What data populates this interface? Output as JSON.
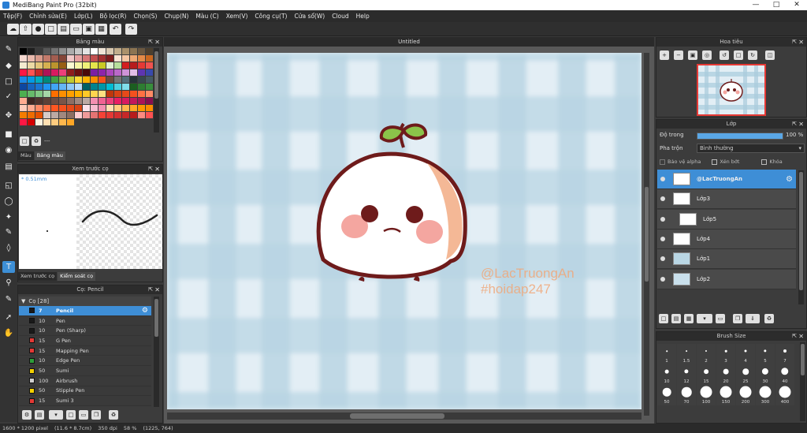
{
  "window": {
    "title": "MediBang Paint Pro (32bit)"
  },
  "menu": [
    "Tệp(F)",
    "Chỉnh sửa(E)",
    "Lớp(L)",
    "Bộ lọc(R)",
    "Chọn(S)",
    "Chụp(N)",
    "Màu (C)",
    "Xem(V)",
    "Công cụ(T)",
    "Cửa sổ(W)",
    "Cloud",
    "Help"
  ],
  "color_palette": {
    "title": "Bảng màu",
    "tab_color": "Màu",
    "tab_palette": "Bảng màu",
    "footer_text": "---",
    "swatches": [
      "#000000",
      "#1e1e1e",
      "#3a3a3a",
      "#575757",
      "#737373",
      "#8f8f8f",
      "#ababab",
      "#c7c7c7",
      "#e3e3e3",
      "#ffffff",
      "#efe4d6",
      "#d9c8b0",
      "#c2ad8c",
      "#aa916b",
      "#8c7452",
      "#6b5840",
      "#4c3f2e",
      "#f4d7cf",
      "#e9b9ac",
      "#d89a8b",
      "#c27a6b",
      "#a35d50",
      "#844538",
      "#f1c8c8",
      "#e6a0a0",
      "#d77878",
      "#c25050",
      "#a33030",
      "#7f1d1d",
      "#fbe3d3",
      "#f5c6a3",
      "#eea874",
      "#e38a48",
      "#c9671f",
      "#f5ebd0",
      "#ecd9a5",
      "#e3c57a",
      "#d6b050",
      "#bc942d",
      "#985f14",
      "#fcfcd2",
      "#f7f7a5",
      "#f0f078",
      "#e6e64b",
      "#c9c924",
      "#e0f0d2",
      "#b8e09c",
      "#d21f1f",
      "#b71c1c",
      "#e53935",
      "#ef5350",
      "#ff1744",
      "#ff5252",
      "#c62828",
      "#ad1457",
      "#d81b60",
      "#ec407a",
      "#8e1d1d",
      "#6a1010",
      "#4a0a0a",
      "#7b1fa2",
      "#8e24aa",
      "#ab47bc",
      "#ba68c8",
      "#ce93d8",
      "#e1bee7",
      "#5e35b1",
      "#3949ab",
      "#1e88e5",
      "#039be5",
      "#00acc1",
      "#00897b",
      "#43a047",
      "#7cb342",
      "#c0ca33",
      "#fdd835",
      "#ffb300",
      "#fb8c00",
      "#f4511e",
      "#6d4c41",
      "#757575",
      "#546e7a",
      "#263238",
      "#37474f",
      "#455a64",
      "#0d47a1",
      "#1565c0",
      "#1976d2",
      "#2196f3",
      "#42a5f5",
      "#64b5f6",
      "#90caf9",
      "#bbdefb",
      "#006064",
      "#00838f",
      "#0097a7",
      "#00bcd4",
      "#4dd0e1",
      "#80deea",
      "#1b5e20",
      "#2e7d32",
      "#388e3c",
      "#4caf50",
      "#66bb6a",
      "#81c784",
      "#a5d6a7",
      "#ff6f00",
      "#ff8f00",
      "#ffa000",
      "#ffb300",
      "#ffca28",
      "#ffd54f",
      "#ffe082",
      "#bf360c",
      "#d84315",
      "#e64a19",
      "#f4511e",
      "#ff7043",
      "#ff8a65",
      "#ffab91",
      "#3e2723",
      "#4e342e",
      "#5d4037",
      "#6d4c41",
      "#795548",
      "#8d6e63",
      "#a1887f",
      "#bcaaa4",
      "#f48fb1",
      "#f06292",
      "#ec407a",
      "#e91e63",
      "#d81b60",
      "#c2185b",
      "#ad1457",
      "#880e4f",
      "#ffccbc",
      "#ffab91",
      "#ff8a65",
      "#ff7043",
      "#ff5722",
      "#f4511e",
      "#e64a19",
      "#d84315",
      "#fce4ec",
      "#f8bbd0",
      "#f48fb1",
      "#ffe0b2",
      "#ffcc80",
      "#ffb74d",
      "#ffa726",
      "#ff9800",
      "#fb8c00",
      "#f57c00",
      "#ef6c00",
      "#e65100",
      "#d7ccc8",
      "#bcaaa4",
      "#a1887f",
      "#8d6e63",
      "#ffcdd2",
      "#ef9a9a",
      "#e57373",
      "#f44336",
      "#e53935",
      "#d32f2f",
      "#c62828",
      "#b71c1c",
      "#ff8a80",
      "#ff5252",
      "#ff1744",
      "#d50000",
      "#fff3e0",
      "#ffe0b2",
      "#ffcc80",
      "#ffb74d",
      "#ffa726"
    ]
  },
  "brush_preview": {
    "title": "Xem trước cọ",
    "size_label": "* 0.51mm",
    "tab_preview": "Xem trước cọ",
    "tab_control": "Kiểm soát cọ"
  },
  "brush_panel": {
    "title": "Cọ: Pencil",
    "group": "Cọ [28]",
    "brushes": [
      {
        "size": "7",
        "name": "Pencil",
        "color": "#1a1a1a"
      },
      {
        "size": "10",
        "name": "Pen",
        "color": "#1a1a1a"
      },
      {
        "size": "10",
        "name": "Pen (Sharp)",
        "color": "#1a1a1a"
      },
      {
        "size": "15",
        "name": "G Pen",
        "color": "#e53935"
      },
      {
        "size": "15",
        "name": "Mapping Pen",
        "color": "#e53935"
      },
      {
        "size": "10",
        "name": "Edge Pen",
        "color": "#2e9e3a"
      },
      {
        "size": "50",
        "name": "Sumi",
        "color": "#f5d000"
      },
      {
        "size": "100",
        "name": "Airbrush",
        "color": "#d0d0d0"
      },
      {
        "size": "50",
        "name": "Stipple Pen",
        "color": "#f5d000"
      },
      {
        "size": "15",
        "name": "Sumi 3",
        "color": "#e53935"
      }
    ]
  },
  "canvas": {
    "document_title": "Untitled",
    "watermark_line1": "@LacTruongAn",
    "watermark_line2": "#hoidap247"
  },
  "navigator": {
    "title": "Hoa tiêu"
  },
  "layers": {
    "title": "Lớp",
    "opacity_label": "Độ trong",
    "opacity_value": "100 %",
    "opacity_fraction": 1.0,
    "blend_label": "Pha trộn",
    "blend_value": "Bình thường",
    "protect_alpha": "Bảo vệ alpha",
    "clipping": "Xén bớt",
    "lock": "Khóa",
    "items": [
      {
        "name": "@LacTruongAn"
      },
      {
        "name": "Lớp3"
      },
      {
        "name": "Lớp5"
      },
      {
        "name": "Lớp4"
      },
      {
        "name": "Lớp1"
      },
      {
        "name": "Lớp2"
      }
    ]
  },
  "brush_size": {
    "title": "Brush Size",
    "sizes": [
      "1",
      "1.5",
      "2",
      "3",
      "4",
      "5",
      "7",
      "10",
      "12",
      "15",
      "20",
      "25",
      "30",
      "40",
      "50",
      "70",
      "100",
      "150",
      "200",
      "300",
      "400"
    ]
  },
  "status": {
    "image_size": "1600 * 1200 pixel",
    "physical_size": "(11.6 * 8.7cm)",
    "dpi": "350 dpi",
    "zoom": "58 %",
    "cursor": "(1225, 764)"
  },
  "colors": {
    "accent": "#3e8ed6",
    "canvas_bg": "#dbe9f2",
    "gingham": "#a9cbdc",
    "character_outline": "#6e1b1b",
    "watermark": "#f0a87a"
  }
}
